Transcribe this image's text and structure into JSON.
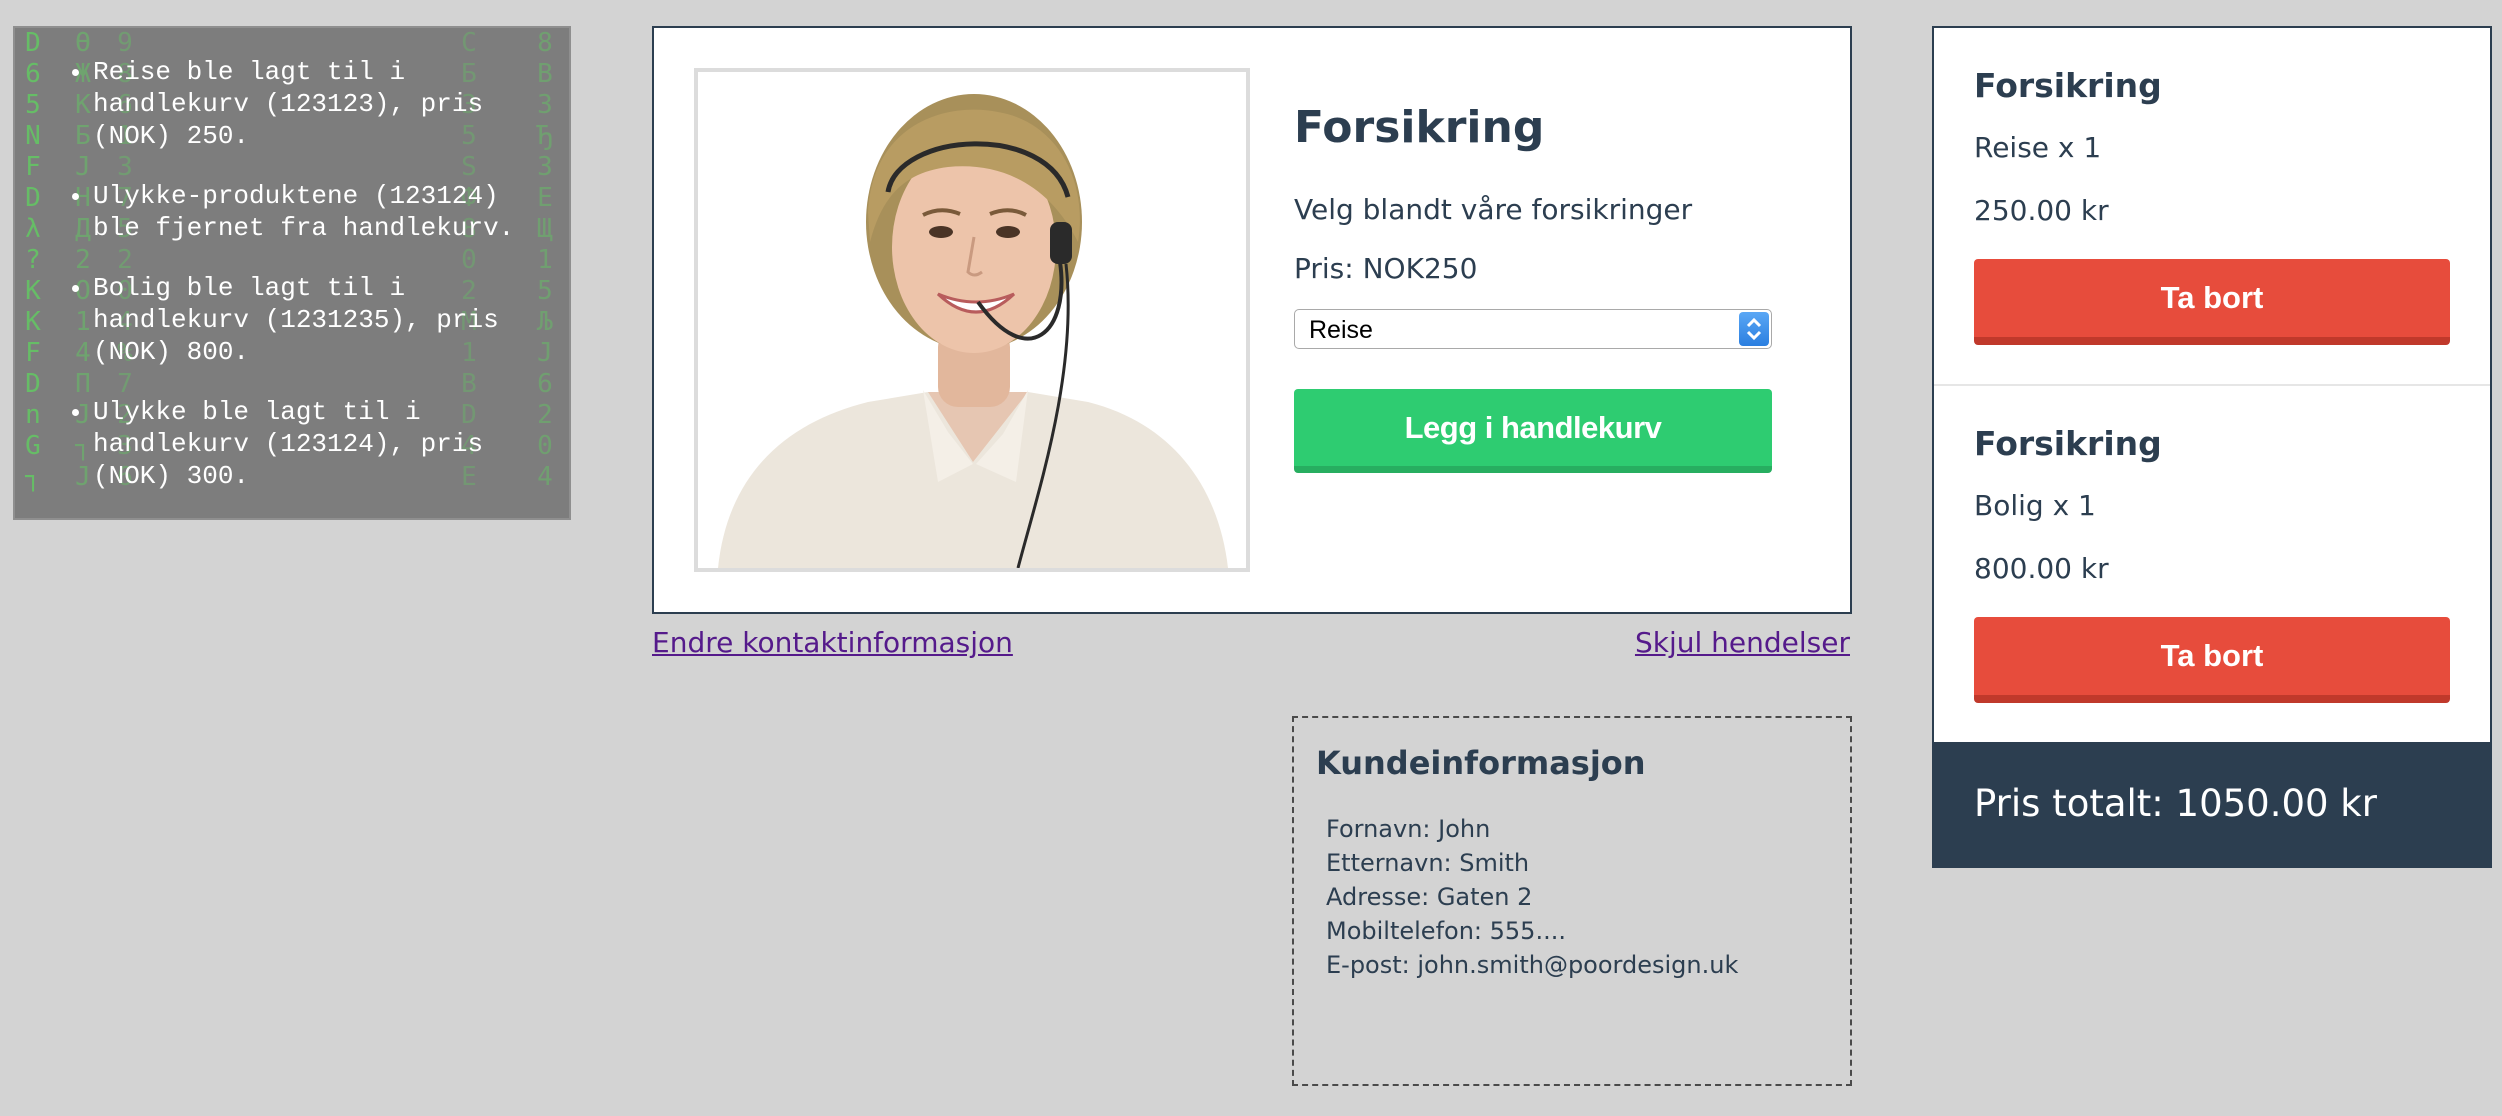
{
  "events": [
    "Reise ble lagt til i handlekurv (123123), pris (NOK) 250.",
    "Ulykke-produktene (123124) ble fjernet fra handlekurv.",
    "Bolig ble lagt til i handlekurv (1231235), pris (NOK) 800.",
    "Ulykke ble lagt til i handlekurv (123124), pris (NOK) 300."
  ],
  "matrix_glyphs": [
    "D\n6\n5\nN\nF\nD\nλ\n?\nK\nK\nF\nD\nn\nG\n┐",
    "Ө\nЖ\nK\nБ\nJ\nH\nД\n2\nO\n1\n4\nП\nJ\n┐\nJ",
    "9\n8\n6\n1\n3\n7\n5\n2\n0\n4\n%\n7\n2\n3\n6",
    "C\nБ\n3\n5\nS\nФ\n8\n0\n2\nM\n1\nB\nD\n4\nE",
    "8\nB\n3\nЂ\n3\nE\nЩ\n1\n5\nЉ\nJ\n6\n2\n0\n4"
  ],
  "product": {
    "title": "Forsikring",
    "description": "Velg blandt våre forsikringer",
    "price": "Pris: NOK250",
    "selected_option": "Reise",
    "add_button": "Legg i handlekurv"
  },
  "links": {
    "edit_contact": "Endre kontaktinformasjon",
    "hide_events": "Skjul hendelser"
  },
  "customer": {
    "title": "Kundeinformasjon",
    "fields": [
      "Fornavn: John",
      "Etternavn: Smith",
      "Adresse: Gaten 2",
      "Mobiltelefon: 555....",
      "E-post: john.smith@poordesign.uk"
    ]
  },
  "cart": {
    "items": [
      {
        "title": "Forsikring",
        "qty": "Reise x 1",
        "price": "250.00 kr",
        "remove_label": "Ta bort"
      },
      {
        "title": "Forsikring",
        "qty": "Bolig x 1",
        "price": "800.00 kr",
        "remove_label": "Ta bort"
      }
    ],
    "total": "Pris totalt: 1050.00 kr"
  },
  "colors": {
    "background": "#d3d3d3",
    "navy": "#2c3e50",
    "green": "#2ecc71",
    "red": "#e74c3c",
    "link": "#551a8b",
    "matrix_green": "#5fd35f"
  }
}
